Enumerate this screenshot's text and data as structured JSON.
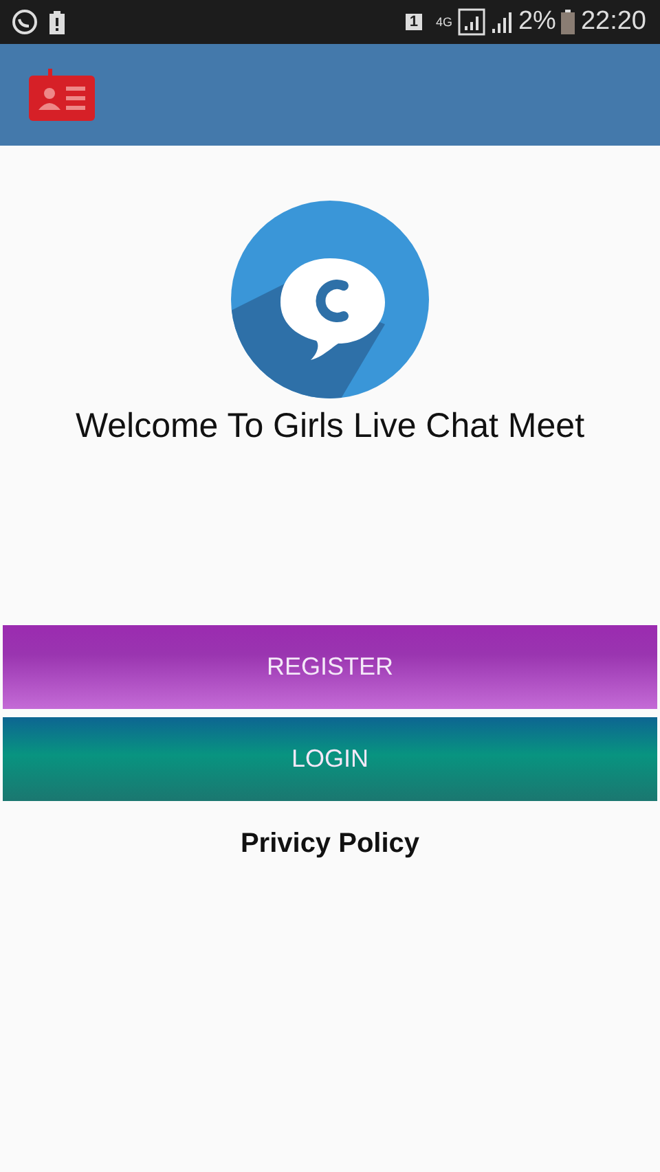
{
  "status_bar": {
    "sim_slot": "1",
    "network": "4G",
    "battery": "2%",
    "time": "22:20"
  },
  "welcome": "Welcome To Girls Live Chat Meet",
  "buttons": [
    {
      "label": "REGISTER",
      "kind": "purple"
    },
    {
      "label": "LOGIN",
      "kind": "teal"
    }
  ],
  "privacy_link": "Privicy Policy"
}
